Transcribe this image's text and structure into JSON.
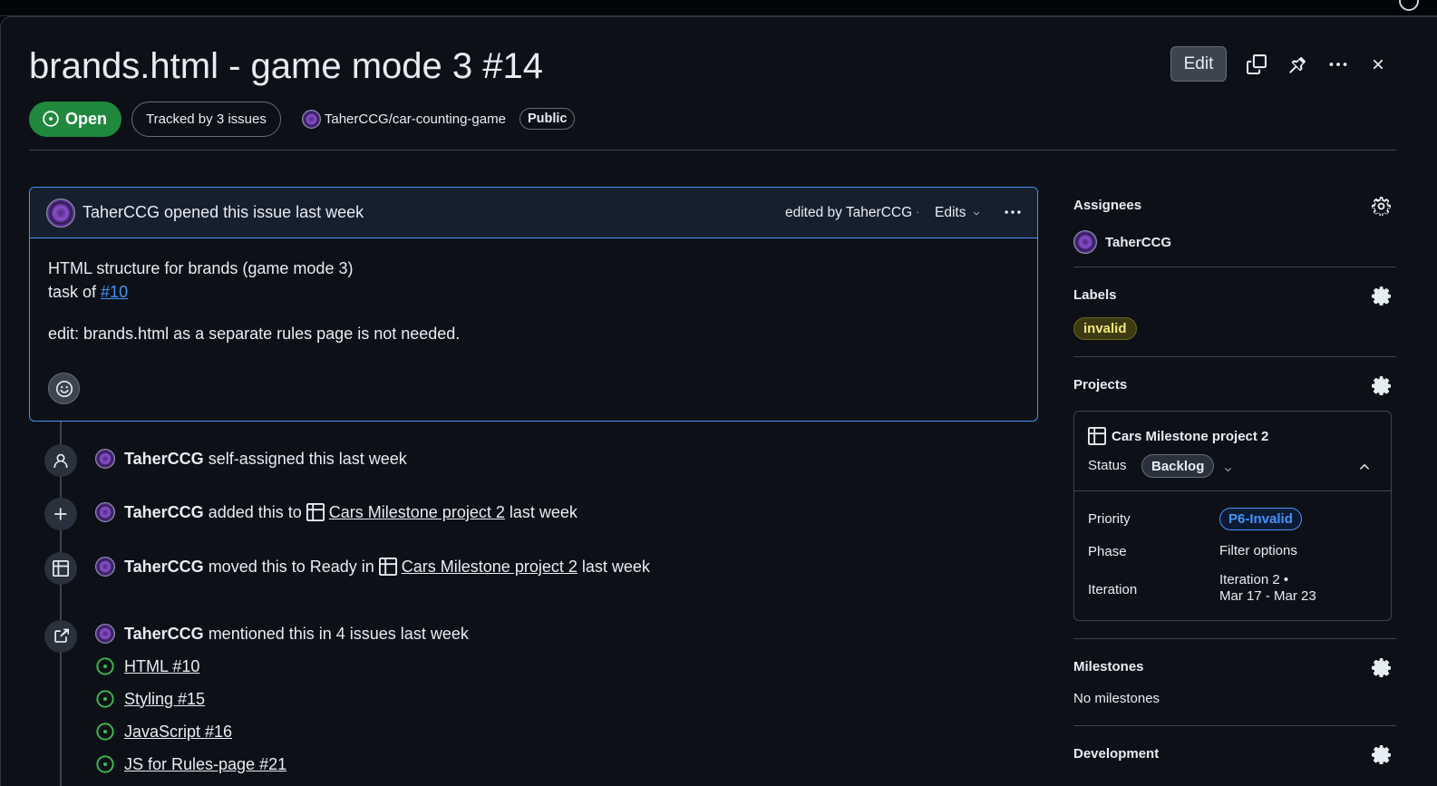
{
  "issue": {
    "title": "brands.html - game mode 3 #14",
    "state": "Open",
    "tracked": "Tracked by 3 issues",
    "repo": "TaherCCG/car-counting-game",
    "visibility": "Public"
  },
  "header_actions": {
    "edit": "Edit",
    "icons": [
      "copy-icon",
      "pin-icon",
      "kebab-icon",
      "close-icon"
    ]
  },
  "comment": {
    "author": "TaherCCG",
    "opened_text": "opened this issue last week",
    "edited_text": "edited by TaherCCG",
    "separator": "·",
    "edits_label": "Edits",
    "body_line1": "HTML structure for brands (game mode 3)",
    "body_line2_prefix": "task of",
    "body_line2_link": "#10",
    "body_line3": "edit: brands.html as a separate rules page is not needed."
  },
  "timeline": [
    {
      "icon": "person-icon",
      "actor": "TaherCCG",
      "text": "self-assigned this last week"
    },
    {
      "icon": "plus-icon",
      "actor": "TaherCCG",
      "pre": "added this to",
      "project": "Cars Milestone project 2",
      "post": "last week"
    },
    {
      "icon": "table-icon",
      "actor": "TaherCCG",
      "pre": "moved this to Ready in",
      "project": "Cars Milestone project 2",
      "post": "last week"
    },
    {
      "icon": "external-link-icon",
      "actor": "TaherCCG",
      "text": "mentioned this in 4 issues last week"
    }
  ],
  "mentions": [
    "HTML #10",
    "Styling #15",
    "JavaScript #16",
    "JS for Rules-page #21"
  ],
  "sidebar": {
    "assignees": {
      "title": "Assignees",
      "user": "TaherCCG"
    },
    "labels": {
      "title": "Labels",
      "items": [
        "invalid"
      ]
    },
    "projects": {
      "title": "Projects",
      "project_name": "Cars Milestone project 2",
      "status_label": "Status",
      "status_value": "Backlog",
      "priority_label": "Priority",
      "priority_value": "P6-Invalid",
      "phase_label": "Phase",
      "phase_value": "Filter options",
      "iteration_label": "Iteration",
      "iteration_value_1": "Iteration 2 •",
      "iteration_value_2": "Mar 17 - Mar 23"
    },
    "milestones": {
      "title": "Milestones",
      "value": "No milestones"
    },
    "development": {
      "title": "Development"
    }
  },
  "colors": {
    "background": "#0d1117",
    "open_green": "#1f883d",
    "accent_blue": "#4493f8",
    "label_invalid": "#f0e87a"
  }
}
